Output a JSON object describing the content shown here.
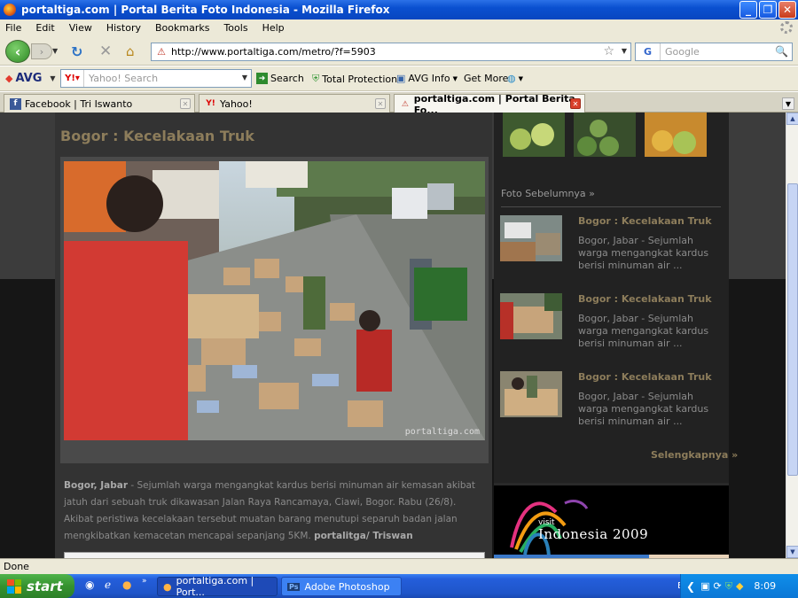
{
  "window": {
    "title": "portaltiga.com | Portal Berita Foto Indonesia - Mozilla Firefox"
  },
  "menu": [
    "File",
    "Edit",
    "View",
    "History",
    "Bookmarks",
    "Tools",
    "Help"
  ],
  "nav": {
    "url": "http://www.portaltiga.com/metro/?f=5903",
    "search_placeholder": "Google"
  },
  "avg": {
    "logo": "AVG",
    "search_placeholder": "Yahoo! Search",
    "search_label": "Search",
    "protection": "Total Protection",
    "info": "AVG Info",
    "more": "Get More"
  },
  "tabs": [
    {
      "label": "Facebook | Tri Iswanto",
      "icon": "f"
    },
    {
      "label": "Yahoo!",
      "icon": "Y!"
    },
    {
      "label": "portaltiga.com | Portal Berita Fo...",
      "icon": "!"
    }
  ],
  "page": {
    "heading": "Bogor : Kecelakaan Truk",
    "watermark": "portaltiga.com",
    "caption_place": "Bogor, Jabar",
    "caption_body": " - Sejumlah warga mengangkat kardus berisi minuman air kemasan akibat jatuh dari sebuah truk dikawasan Jalan Raya Rancamaya, Ciawi, Bogor. Rabu (26/8). Akibat peristiwa kecelakaan tersebut muatan barang menutupi separuh badan jalan mengkibatkan kemacetan mencapai sepanjang 5KM. ",
    "caption_credit": "portalitga/ Triswan",
    "prev_label": "Foto Sebelumnya »",
    "items": [
      {
        "title": "Bogor : Kecelakaan Truk",
        "desc": "Bogor, Jabar - Sejumlah warga mengangkat kardus berisi minuman air ..."
      },
      {
        "title": "Bogor : Kecelakaan Truk",
        "desc": "Bogor, Jabar - Sejumlah warga mengangkat kardus berisi minuman air ..."
      },
      {
        "title": "Bogor : Kecelakaan Truk",
        "desc": "Bogor, Jabar - Sejumlah warga mengangkat kardus berisi minuman air ..."
      }
    ],
    "more_label": "Selengkapnya »",
    "banner_visit": "visit",
    "banner_text": "Indonesia 2009"
  },
  "status": "Done",
  "taskbar": {
    "start": "start",
    "tasks": [
      "portaltiga.com | Port...",
      "Adobe Photoshop"
    ],
    "lang": "EN",
    "time": "8:09"
  }
}
